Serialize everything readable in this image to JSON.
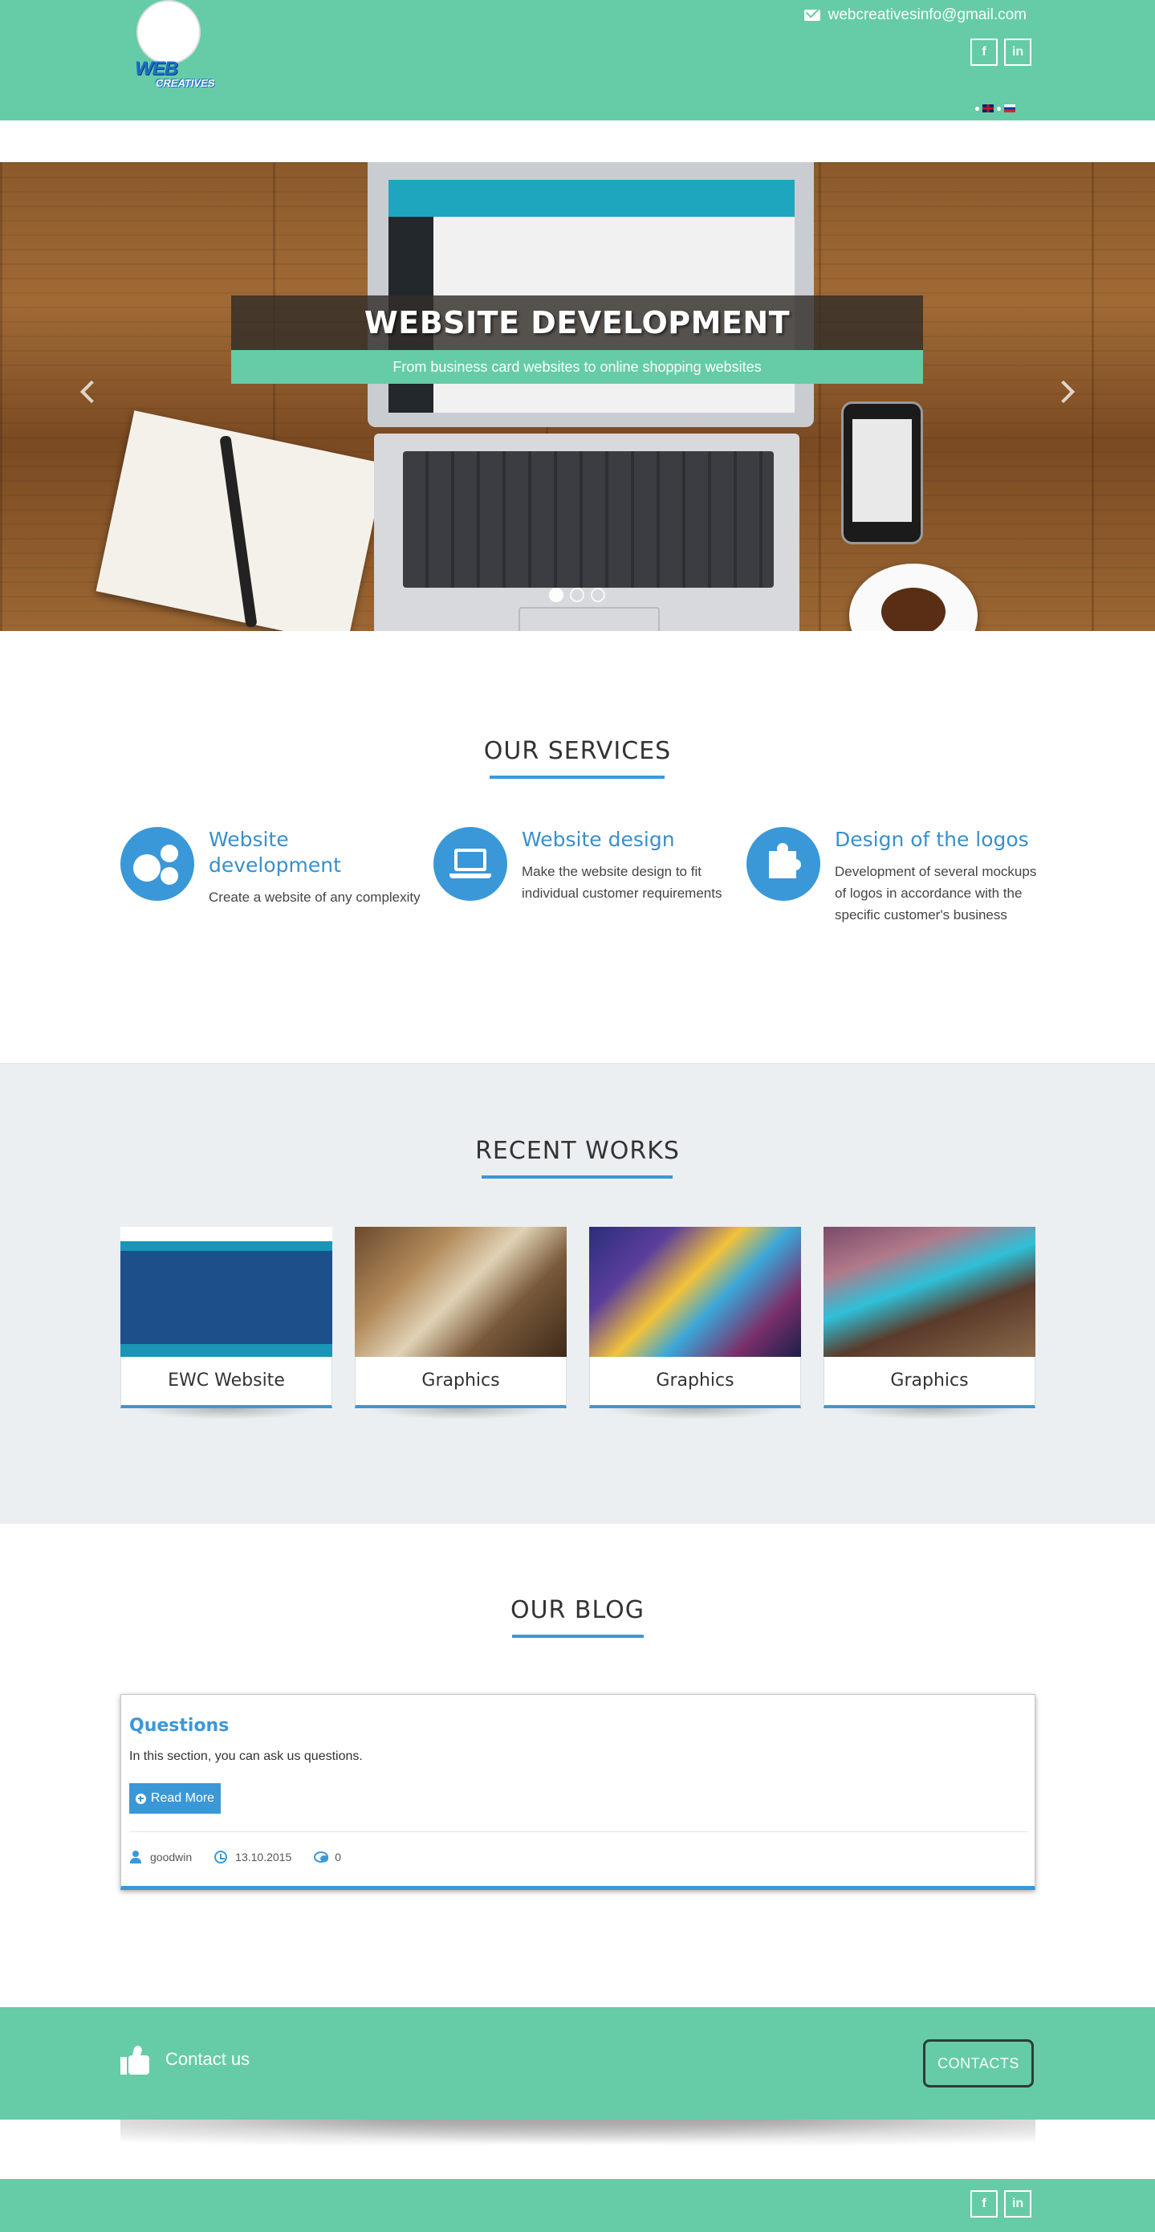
{
  "header": {
    "email": "webcreativesinfo@gmail.com",
    "logo_text_main": "WEB",
    "logo_text_sub": "CREATIVES",
    "social": {
      "facebook": "f",
      "linkedin": "in"
    },
    "languages": [
      "English",
      "Russian"
    ]
  },
  "slider": {
    "title": "WEBSITE DEVELOPMENT",
    "subtitle": "From business card websites to online shopping websites",
    "slides_count": 3,
    "active_slide": 1
  },
  "services": {
    "title": "OUR SERVICES",
    "items": [
      {
        "title": "Website development",
        "description": "Create a website of any complexity",
        "icon": "gears-icon"
      },
      {
        "title": "Website design",
        "description": "Make the website design to fit individual customer requirements",
        "icon": "laptop-icon"
      },
      {
        "title": "Design of the logos",
        "description": "Development of several mockups of logos in accordance with the specific customer's business",
        "icon": "puzzle-icon"
      }
    ]
  },
  "works": {
    "title": "RECENT WORKS",
    "items": [
      {
        "label": "EWC Website"
      },
      {
        "label": "Graphics"
      },
      {
        "label": "Graphics"
      },
      {
        "label": "Graphics"
      }
    ]
  },
  "blog": {
    "title": "OUR BLOG",
    "post": {
      "title": "Questions",
      "excerpt": "In this section, you can ask us questions.",
      "read_more": "Read More",
      "author": "goodwin",
      "date": "13.10.2015",
      "comments": "0"
    }
  },
  "contact_bar": {
    "text": "Contact us",
    "button": "CONTACTS"
  },
  "footer": {
    "social": {
      "facebook": "f",
      "linkedin": "in"
    }
  },
  "colors": {
    "accent_green": "#65cca7",
    "accent_blue": "#3a98d8",
    "works_bg": "#eceff1"
  }
}
